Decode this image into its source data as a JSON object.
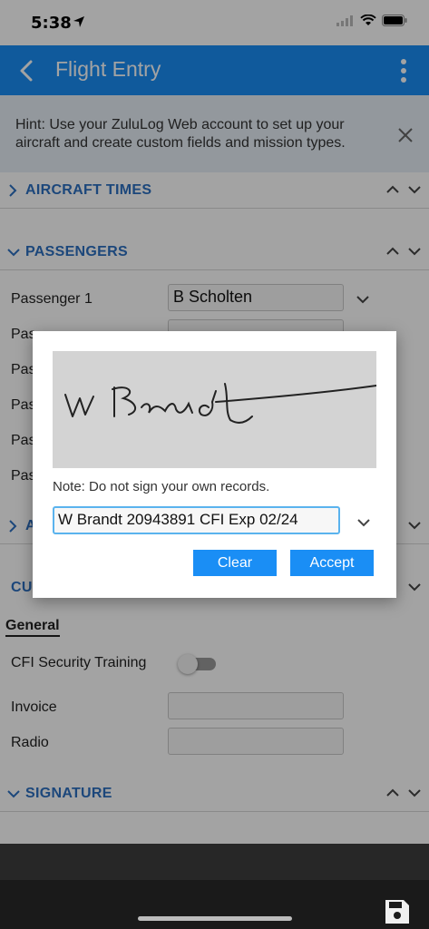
{
  "status": {
    "time": "5:38"
  },
  "app_bar": {
    "title": "Flight Entry"
  },
  "hint": {
    "text": "Hint: Use your ZuluLog Web account to set up your aircraft and create custom fields and mission types."
  },
  "sections": {
    "aircraft_times": "AIRCRAFT TIMES",
    "passengers": "PASSENGERS",
    "collapsed_partial": "A",
    "custom_partial": "CU",
    "signature": "SIGNATURE"
  },
  "passengers": {
    "labels": [
      "Passenger 1",
      "Pas",
      "Pas",
      "Pas",
      "Pas",
      "Pas"
    ],
    "passenger1_value": "B Scholten"
  },
  "custom_fields": {
    "tab": "General",
    "cfi_label": "CFI Security Training",
    "cfi_value": false,
    "invoice_label": "Invoice",
    "radio_label": "Radio"
  },
  "dialog": {
    "note": "Note: Do not sign your own records.",
    "signer_value": "W Brandt 20943891 CFI Exp 02/24",
    "clear_label": "Clear",
    "accept_label": "Accept"
  },
  "colors": {
    "accent": "#1a8ef5",
    "section_title": "#2c6fc0",
    "overlay": "#000000"
  },
  "icons": {
    "back": "chevron-left-icon",
    "menu": "more-vertical-icon",
    "close": "close-icon",
    "save": "save-icon"
  }
}
